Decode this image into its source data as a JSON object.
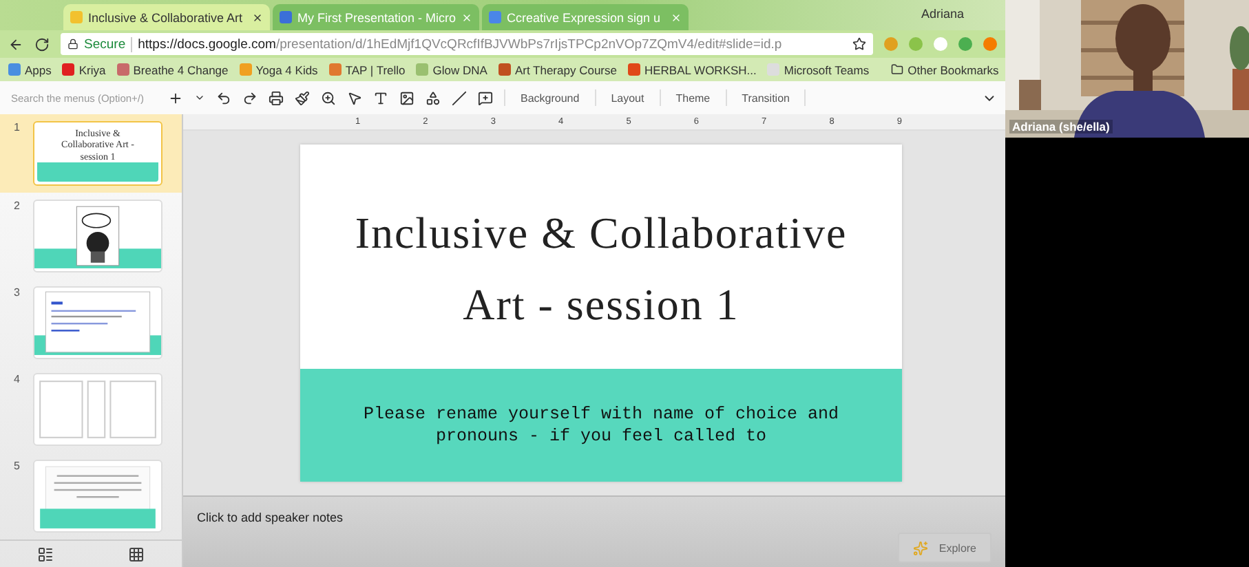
{
  "browser": {
    "tabs": [
      {
        "title": "Inclusive & Collaborative Art",
        "selected": true
      },
      {
        "title": "My First Presentation - Micro",
        "selected": false
      },
      {
        "title": "Ccreative Expression sign u",
        "selected": false
      }
    ],
    "profile": "Adriana",
    "address": {
      "secure": "Secure",
      "host": "https://docs.google.com",
      "path": "/presentation/d/1hEdMjf1QVcQRcfIfBJVWbPs7rIjsTPCp2nVOp7ZQmV4/edit#slide=id.p"
    },
    "bookmarks": [
      {
        "label": "Apps",
        "color": "#4a8fe0"
      },
      {
        "label": "Kriya",
        "color": "#e02020"
      },
      {
        "label": "Breathe 4 Change",
        "color": "#c86a6a"
      },
      {
        "label": "Yoga 4 Kids",
        "color": "#f0a020"
      },
      {
        "label": "TAP | Trello",
        "color": "#e07830"
      },
      {
        "label": "Glow DNA",
        "color": "#9ac070"
      },
      {
        "label": "Art Therapy Course",
        "color": "#c05020"
      },
      {
        "label": "HERBAL WORKSH...",
        "color": "#e04818"
      },
      {
        "label": "Microsoft Teams",
        "color": "#dddddd"
      }
    ],
    "other_bookmarks": "Other Bookmarks"
  },
  "toolbar": {
    "search_placeholder": "Search the menus (Option+/)",
    "buttons": [
      "Background",
      "Layout",
      "Theme",
      "Transition"
    ]
  },
  "ruler": [
    "1",
    "2",
    "3",
    "4",
    "5",
    "6",
    "7",
    "8",
    "9"
  ],
  "thumbnails": [
    {
      "number": "1",
      "kind": "title",
      "selected": true,
      "title": "Inclusive & Collaborative Art - session 1"
    },
    {
      "number": "2",
      "kind": "picture",
      "selected": false
    },
    {
      "number": "3",
      "kind": "document",
      "selected": false
    },
    {
      "number": "4",
      "kind": "columns",
      "selected": false
    },
    {
      "number": "5",
      "kind": "text",
      "selected": false
    }
  ],
  "slide": {
    "title": "Inclusive & Collaborative Art - session 1",
    "body": "Please rename yourself with name of choice and pronouns - if you feel called to"
  },
  "notes": {
    "placeholder": "Click to add speaker notes"
  },
  "explore": "Explore",
  "video": {
    "name": "Adriana (she/ella)"
  }
}
